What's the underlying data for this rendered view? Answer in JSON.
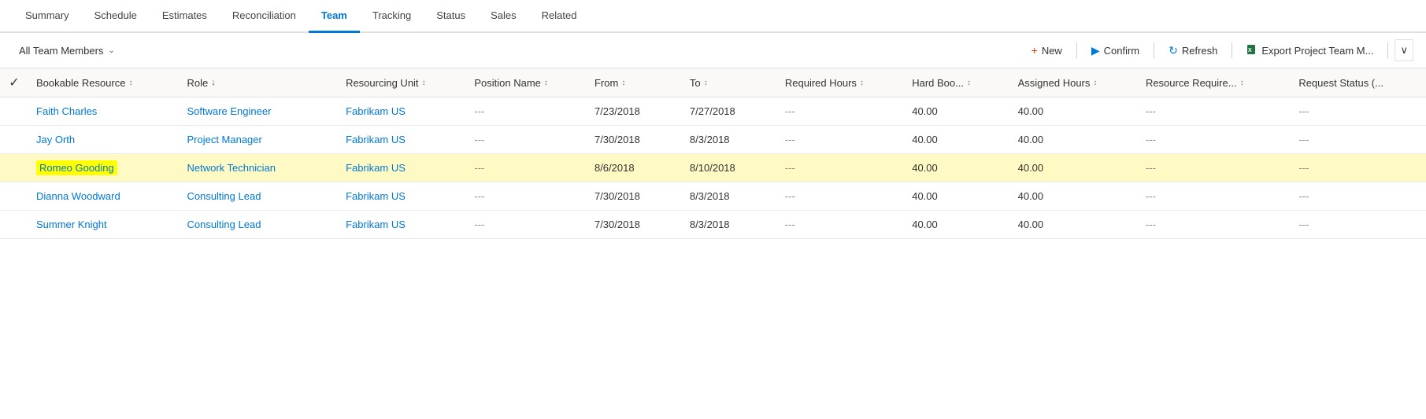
{
  "nav": {
    "tabs": [
      {
        "label": "Summary",
        "active": false
      },
      {
        "label": "Schedule",
        "active": false
      },
      {
        "label": "Estimates",
        "active": false
      },
      {
        "label": "Reconciliation",
        "active": false
      },
      {
        "label": "Team",
        "active": true
      },
      {
        "label": "Tracking",
        "active": false
      },
      {
        "label": "Status",
        "active": false
      },
      {
        "label": "Sales",
        "active": false
      },
      {
        "label": "Related",
        "active": false
      }
    ]
  },
  "toolbar": {
    "filter_label": "All Team Members",
    "new_label": "New",
    "confirm_label": "Confirm",
    "refresh_label": "Refresh",
    "export_label": "Export Project Team M..."
  },
  "table": {
    "columns": [
      {
        "label": "Bookable Resource",
        "sort": "updown"
      },
      {
        "label": "Role",
        "sort": "down"
      },
      {
        "label": "Resourcing Unit",
        "sort": "updown"
      },
      {
        "label": "Position Name",
        "sort": "updown"
      },
      {
        "label": "From",
        "sort": "updown"
      },
      {
        "label": "To",
        "sort": "updown"
      },
      {
        "label": "Required Hours",
        "sort": "updown"
      },
      {
        "label": "Hard Boo...",
        "sort": "updown"
      },
      {
        "label": "Assigned Hours",
        "sort": "updown"
      },
      {
        "label": "Resource Require...",
        "sort": "updown"
      },
      {
        "label": "Request Status (...",
        "sort": "none"
      }
    ],
    "rows": [
      {
        "bookable_resource": "Faith Charles",
        "role": "Software Engineer",
        "resourcing_unit": "Fabrikam US",
        "position_name": "---",
        "from": "7/23/2018",
        "to": "7/27/2018",
        "required_hours": "---",
        "hard_boo": "40.00",
        "assigned_hours": "40.00",
        "resource_require": "---",
        "request_status": "---",
        "highlighted": false
      },
      {
        "bookable_resource": "Jay Orth",
        "role": "Project Manager",
        "resourcing_unit": "Fabrikam US",
        "position_name": "---",
        "from": "7/30/2018",
        "to": "8/3/2018",
        "required_hours": "---",
        "hard_boo": "40.00",
        "assigned_hours": "40.00",
        "resource_require": "---",
        "request_status": "---",
        "highlighted": false
      },
      {
        "bookable_resource": "Romeo Gooding",
        "role": "Network Technician",
        "resourcing_unit": "Fabrikam US",
        "position_name": "---",
        "from": "8/6/2018",
        "to": "8/10/2018",
        "required_hours": "---",
        "hard_boo": "40.00",
        "assigned_hours": "40.00",
        "resource_require": "---",
        "request_status": "---",
        "highlighted": true
      },
      {
        "bookable_resource": "Dianna Woodward",
        "role": "Consulting Lead",
        "resourcing_unit": "Fabrikam US",
        "position_name": "---",
        "from": "7/30/2018",
        "to": "8/3/2018",
        "required_hours": "---",
        "hard_boo": "40.00",
        "assigned_hours": "40.00",
        "resource_require": "---",
        "request_status": "---",
        "highlighted": false
      },
      {
        "bookable_resource": "Summer Knight",
        "role": "Consulting Lead",
        "resourcing_unit": "Fabrikam US",
        "position_name": "---",
        "from": "7/30/2018",
        "to": "8/3/2018",
        "required_hours": "---",
        "hard_boo": "40.00",
        "assigned_hours": "40.00",
        "resource_require": "---",
        "request_status": "---",
        "highlighted": false
      }
    ]
  }
}
